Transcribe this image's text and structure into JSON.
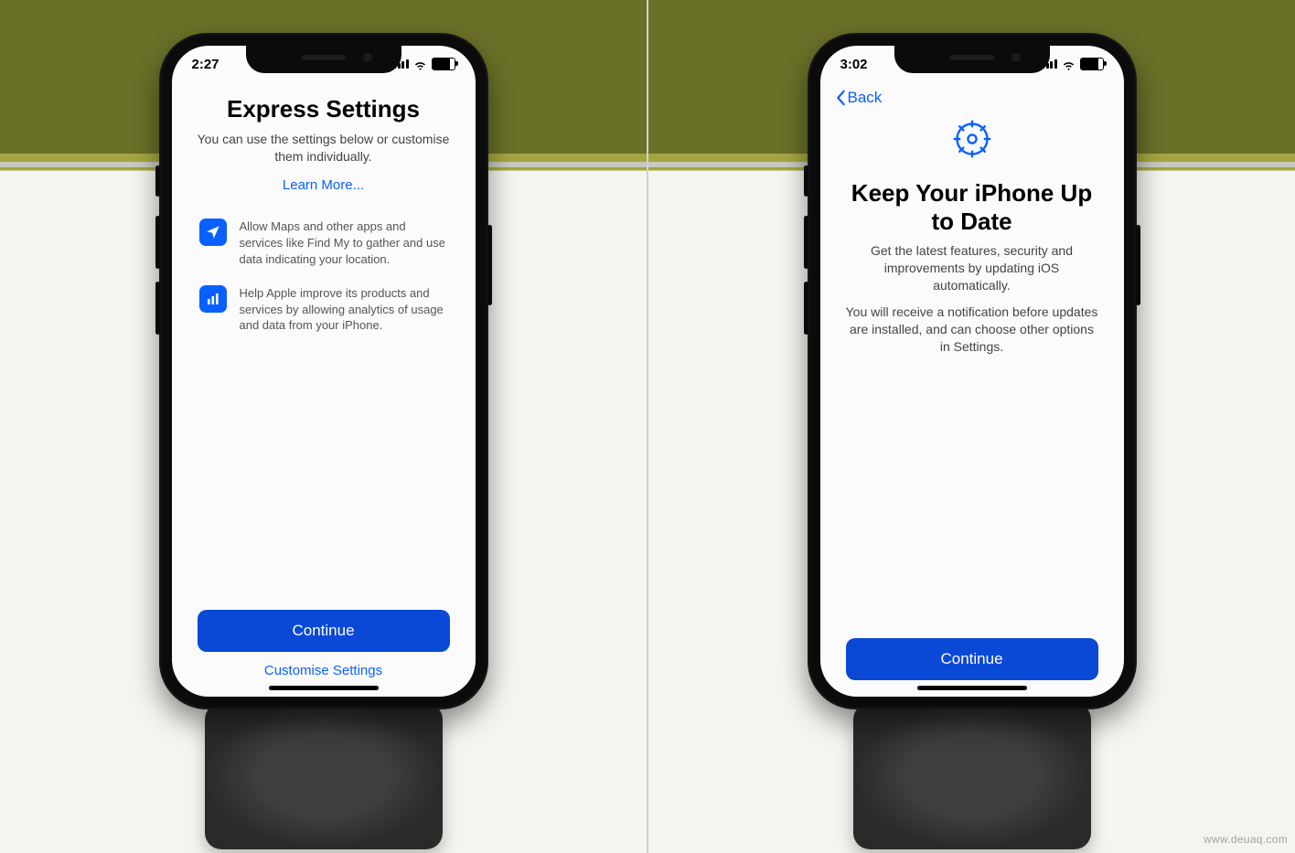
{
  "watermark": "www.deuaq.com",
  "colors": {
    "accent": "#0a60ff",
    "primaryButton": "#0a48d6"
  },
  "left": {
    "status": {
      "time": "2:27"
    },
    "title": "Express Settings",
    "subtitle": "You can use the settings below or customise them individually.",
    "learnMore": "Learn More...",
    "features": [
      {
        "icon": "location-arrow-icon",
        "text": "Allow Maps and other apps and services like Find My to gather and use data indicating your location."
      },
      {
        "icon": "analytics-bars-icon",
        "text": "Help Apple improve its products and services by allowing analytics of usage and data from your iPhone."
      }
    ],
    "primary": "Continue",
    "secondary": "Customise Settings"
  },
  "right": {
    "status": {
      "time": "3:02"
    },
    "back": "Back",
    "title": "Keep Your iPhone Up to Date",
    "subtitle": "Get the latest features, security and improvements by updating iOS automatically.",
    "note": "You will receive a notification before updates are installed, and can choose other options in Settings.",
    "heroIcon": "gear-icon",
    "primary": "Continue"
  }
}
